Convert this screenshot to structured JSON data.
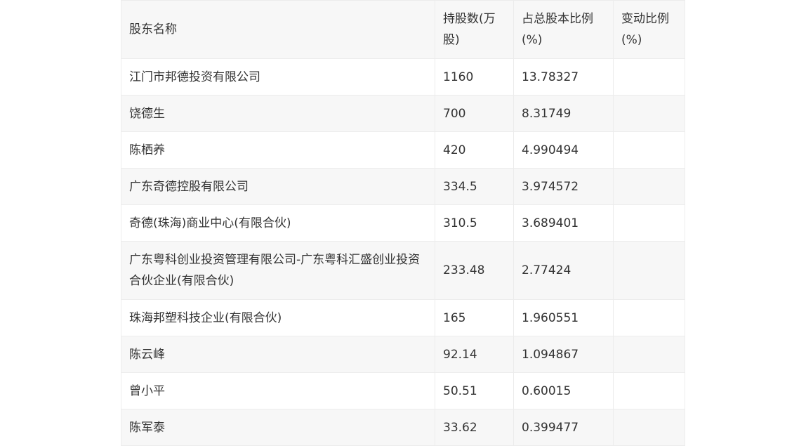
{
  "table": {
    "headers": [
      "股东名称",
      "持股数(万股)",
      "占总股本比例(%)",
      "变动比例(%)"
    ],
    "rows": [
      [
        "江门市邦德投资有限公司",
        "1160",
        "13.78327",
        ""
      ],
      [
        "饶德生",
        "700",
        "8.31749",
        ""
      ],
      [
        "陈栖养",
        "420",
        "4.990494",
        ""
      ],
      [
        "广东奇德控股有限公司",
        "334.5",
        "3.974572",
        ""
      ],
      [
        "奇德(珠海)商业中心(有限合伙)",
        "310.5",
        "3.689401",
        ""
      ],
      [
        "广东粤科创业投资管理有限公司-广东粤科汇盛创业投资合伙企业(有限合伙)",
        "233.48",
        "2.77424",
        ""
      ],
      [
        "珠海邦塑科技企业(有限合伙)",
        "165",
        "1.960551",
        ""
      ],
      [
        "陈云峰",
        "92.14",
        "1.094867",
        ""
      ],
      [
        "曾小平",
        "50.51",
        "0.60015",
        ""
      ],
      [
        "陈军泰",
        "33.62",
        "0.399477",
        ""
      ]
    ]
  }
}
